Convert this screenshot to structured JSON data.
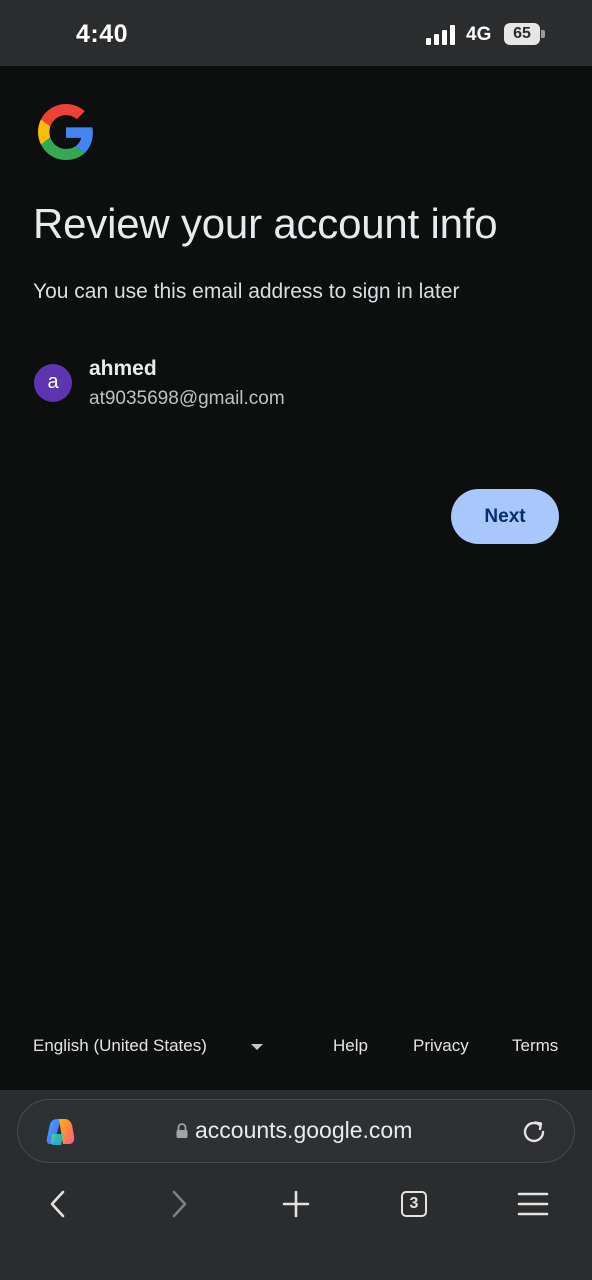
{
  "status_bar": {
    "time": "4:40",
    "network": "4G",
    "battery": "65"
  },
  "page": {
    "title": "Review your account info",
    "subtitle": "You can use this email address to sign in later",
    "account": {
      "avatar_letter": "a",
      "avatar_color": "#5e35b1",
      "name": "ahmed",
      "email": "at9035698@gmail.com"
    },
    "next_label": "Next",
    "accent_color": "#a8c7fa"
  },
  "footer": {
    "language": "English (United States)",
    "links": [
      "Help",
      "Privacy",
      "Terms"
    ]
  },
  "browser": {
    "url": "accounts.google.com",
    "tab_count": "3",
    "icons": [
      "copilot-icon",
      "lock-icon",
      "reload-icon",
      "back-icon",
      "forward-icon",
      "new-tab-icon",
      "tabs-icon",
      "menu-icon"
    ]
  }
}
